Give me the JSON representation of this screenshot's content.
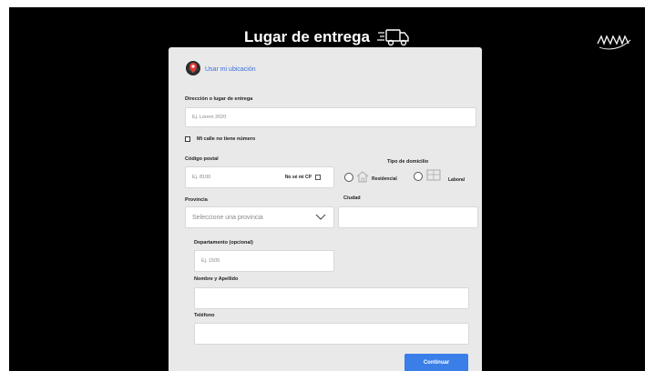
{
  "header": {
    "title": "Lugar de entrega",
    "truck_icon": "truck-icon"
  },
  "brand": {
    "logo_icon": "brand-logo"
  },
  "location": {
    "link": "Usar mi ubicación",
    "icon": "location-pin-icon"
  },
  "address": {
    "label": "Dirección o lugar de entrega",
    "placeholder": "Ej. Lorem 2020"
  },
  "no_number": {
    "label": "Mi calle no tiene número",
    "checked": false
  },
  "postal": {
    "label": "Código postal",
    "placeholder": "Ej. 8100",
    "unknown_label": "No sé mi CP"
  },
  "domicile": {
    "label": "Tipo de domicilio",
    "options": [
      {
        "label": "Residencial",
        "icon": "house-icon"
      },
      {
        "label": "Laboral",
        "icon": "building-icon"
      }
    ]
  },
  "province": {
    "label": "Provincia",
    "placeholder": "Seleccione una provincia"
  },
  "city": {
    "label": "Ciudad"
  },
  "apartment": {
    "label": "Departamento (opcional)",
    "placeholder": "Ej. 1505"
  },
  "fullname": {
    "label": "Nombre y Apellido"
  },
  "phone": {
    "label": "Teléfono"
  },
  "submit": {
    "label": "Continuar"
  },
  "colors": {
    "accent": "#3a7ee8",
    "link": "#3b6fd8",
    "card": "#e9e9e9",
    "background": "#000000"
  }
}
